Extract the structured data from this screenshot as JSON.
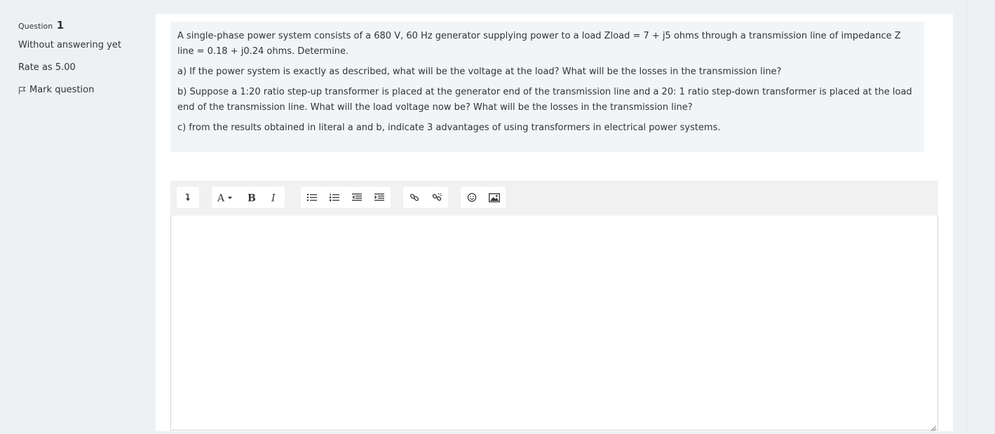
{
  "question_info": {
    "label": "Question",
    "number": "1",
    "status": "Without answering yet",
    "grade": "Rate as 5.00",
    "flag_label": "Mark question"
  },
  "question_text": {
    "intro": "A single-phase power system consists of a 680 V, 60 Hz generator supplying power to a load Zload = 7 + j5 ohms through a transmission line of impedance Z line = 0.18 + j0.24 ohms. Determine.",
    "part_a": " a) If the power system is exactly as described, what will be the voltage at the load? What will be the losses in the transmission line?",
    "part_b": "b) Suppose a 1:20 ratio step-up transformer is placed at the generator end of the transmission line and a 20: 1 ratio step-down transformer is placed at the load end of the transmission line. What will the load voltage now be? What will be the losses in the transmission line?",
    "part_c": "c) from the results obtained in literal a and b, indicate 3 advantages of using transformers in electrical power systems."
  },
  "editor": {
    "value": "",
    "toolbar_icons": [
      "collapse-icon",
      "font-style-icon",
      "bold-icon",
      "italic-icon",
      "unordered-list-icon",
      "ordered-list-icon",
      "outdent-icon",
      "indent-icon",
      "link-icon",
      "unlink-icon",
      "emoji-icon",
      "image-icon"
    ]
  },
  "colors": {
    "page_bg": "#eef1f4",
    "question_text_bg": "#f2f5f8",
    "toolbar_bg": "#f1f1f1",
    "text": "#333333"
  }
}
